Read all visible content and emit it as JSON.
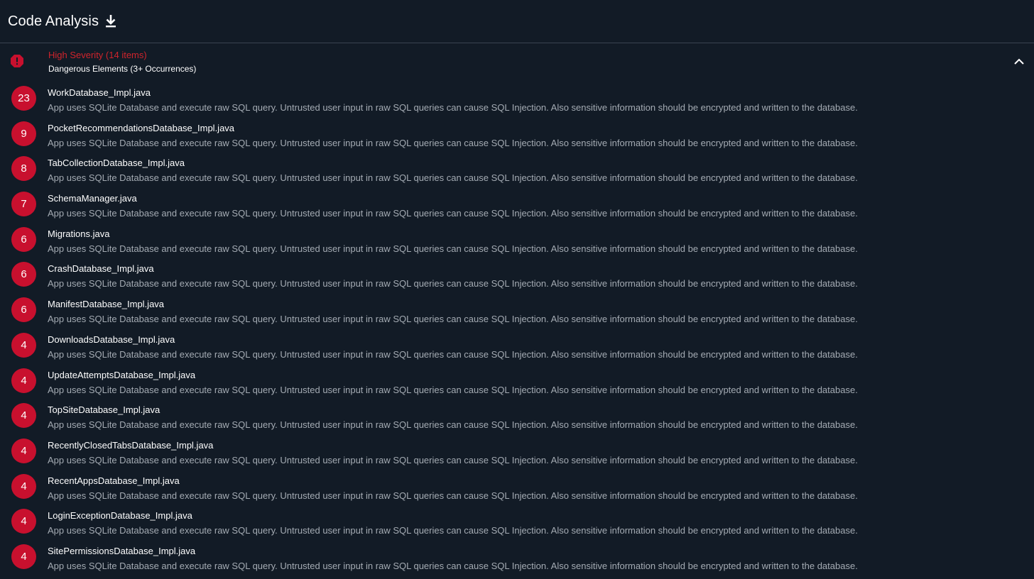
{
  "header": {
    "title": "Code Analysis",
    "download_icon": "download-icon"
  },
  "section": {
    "severity_title": "High Severity (14 items)",
    "subtitle": "Dangerous Elements (3+ Occurrences)",
    "severity_color": "#c8102e",
    "collapse_icon": "chevron-up-icon"
  },
  "items": [
    {
      "count": "23",
      "file": "WorkDatabase_Impl.java",
      "description": "App uses SQLite Database and execute raw SQL query. Untrusted user input in raw SQL queries can cause SQL Injection. Also sensitive information should be encrypted and written to the database."
    },
    {
      "count": "9",
      "file": "PocketRecommendationsDatabase_Impl.java",
      "description": "App uses SQLite Database and execute raw SQL query. Untrusted user input in raw SQL queries can cause SQL Injection. Also sensitive information should be encrypted and written to the database."
    },
    {
      "count": "8",
      "file": "TabCollectionDatabase_Impl.java",
      "description": "App uses SQLite Database and execute raw SQL query. Untrusted user input in raw SQL queries can cause SQL Injection. Also sensitive information should be encrypted and written to the database."
    },
    {
      "count": "7",
      "file": "SchemaManager.java",
      "description": "App uses SQLite Database and execute raw SQL query. Untrusted user input in raw SQL queries can cause SQL Injection. Also sensitive information should be encrypted and written to the database."
    },
    {
      "count": "6",
      "file": "Migrations.java",
      "description": "App uses SQLite Database and execute raw SQL query. Untrusted user input in raw SQL queries can cause SQL Injection. Also sensitive information should be encrypted and written to the database."
    },
    {
      "count": "6",
      "file": "CrashDatabase_Impl.java",
      "description": "App uses SQLite Database and execute raw SQL query. Untrusted user input in raw SQL queries can cause SQL Injection. Also sensitive information should be encrypted and written to the database."
    },
    {
      "count": "6",
      "file": "ManifestDatabase_Impl.java",
      "description": "App uses SQLite Database and execute raw SQL query. Untrusted user input in raw SQL queries can cause SQL Injection. Also sensitive information should be encrypted and written to the database."
    },
    {
      "count": "4",
      "file": "DownloadsDatabase_Impl.java",
      "description": "App uses SQLite Database and execute raw SQL query. Untrusted user input in raw SQL queries can cause SQL Injection. Also sensitive information should be encrypted and written to the database."
    },
    {
      "count": "4",
      "file": "UpdateAttemptsDatabase_Impl.java",
      "description": "App uses SQLite Database and execute raw SQL query. Untrusted user input in raw SQL queries can cause SQL Injection. Also sensitive information should be encrypted and written to the database."
    },
    {
      "count": "4",
      "file": "TopSiteDatabase_Impl.java",
      "description": "App uses SQLite Database and execute raw SQL query. Untrusted user input in raw SQL queries can cause SQL Injection. Also sensitive information should be encrypted and written to the database."
    },
    {
      "count": "4",
      "file": "RecentlyClosedTabsDatabase_Impl.java",
      "description": "App uses SQLite Database and execute raw SQL query. Untrusted user input in raw SQL queries can cause SQL Injection. Also sensitive information should be encrypted and written to the database."
    },
    {
      "count": "4",
      "file": "RecentAppsDatabase_Impl.java",
      "description": "App uses SQLite Database and execute raw SQL query. Untrusted user input in raw SQL queries can cause SQL Injection. Also sensitive information should be encrypted and written to the database."
    },
    {
      "count": "4",
      "file": "LoginExceptionDatabase_Impl.java",
      "description": "App uses SQLite Database and execute raw SQL query. Untrusted user input in raw SQL queries can cause SQL Injection. Also sensitive information should be encrypted and written to the database."
    },
    {
      "count": "4",
      "file": "SitePermissionsDatabase_Impl.java",
      "description": "App uses SQLite Database and execute raw SQL query. Untrusted user input in raw SQL queries can cause SQL Injection. Also sensitive information should be encrypted and written to the database."
    }
  ]
}
